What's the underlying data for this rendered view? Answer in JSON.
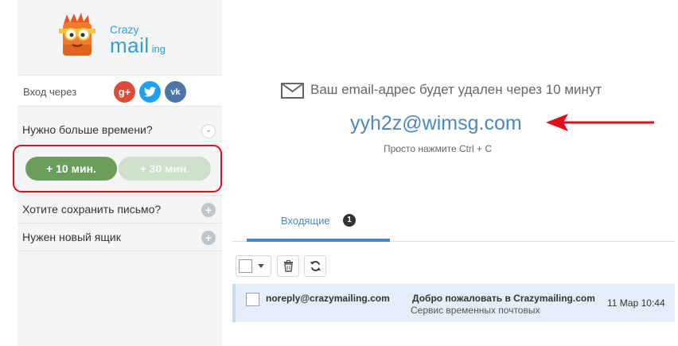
{
  "logo": {
    "crazy": "Crazy",
    "mail": "mail",
    "ing": "ing",
    "icon": "crazy-mascot-logo"
  },
  "sidebar": {
    "login_label": "Вход через",
    "socials": [
      {
        "name": "gplus",
        "glyph": "g+",
        "icon": "google-plus-icon",
        "color": "#dd4b39"
      },
      {
        "name": "twitter",
        "glyph": "🐦",
        "icon": "twitter-icon",
        "color": "#1da1f2"
      },
      {
        "name": "vk",
        "glyph": "vk",
        "icon": "vk-icon",
        "color": "#4a76a8"
      }
    ],
    "more_time": {
      "label": "Нужно больше времени?",
      "toggle": "-"
    },
    "time_buttons": {
      "plus10": "+ 10 мин.",
      "plus30": "+ 30 мин."
    },
    "save_letter": {
      "label": "Хотите сохранить письмо?",
      "toggle": "+"
    },
    "new_box": {
      "label": "Нужен новый ящик",
      "toggle": "+"
    }
  },
  "main": {
    "notice": "Ваш email-адрес будет удален через 10 минут",
    "email": "yyh2z@wimsg.com",
    "hint": "Просто нажмите Ctrl + C",
    "tabs": [
      {
        "label": "Входящие",
        "badge": "1",
        "active": true
      }
    ],
    "accent_color": "#4a86c8",
    "highlight_color": "#e0101a"
  },
  "inbox": {
    "messages": [
      {
        "from": "noreply@crazymailing.com",
        "subject": "Добро пожаловать в Crazymailing.com",
        "snippet": "Сервис временных почтовых",
        "date": "11 Мар 10:44"
      }
    ]
  }
}
